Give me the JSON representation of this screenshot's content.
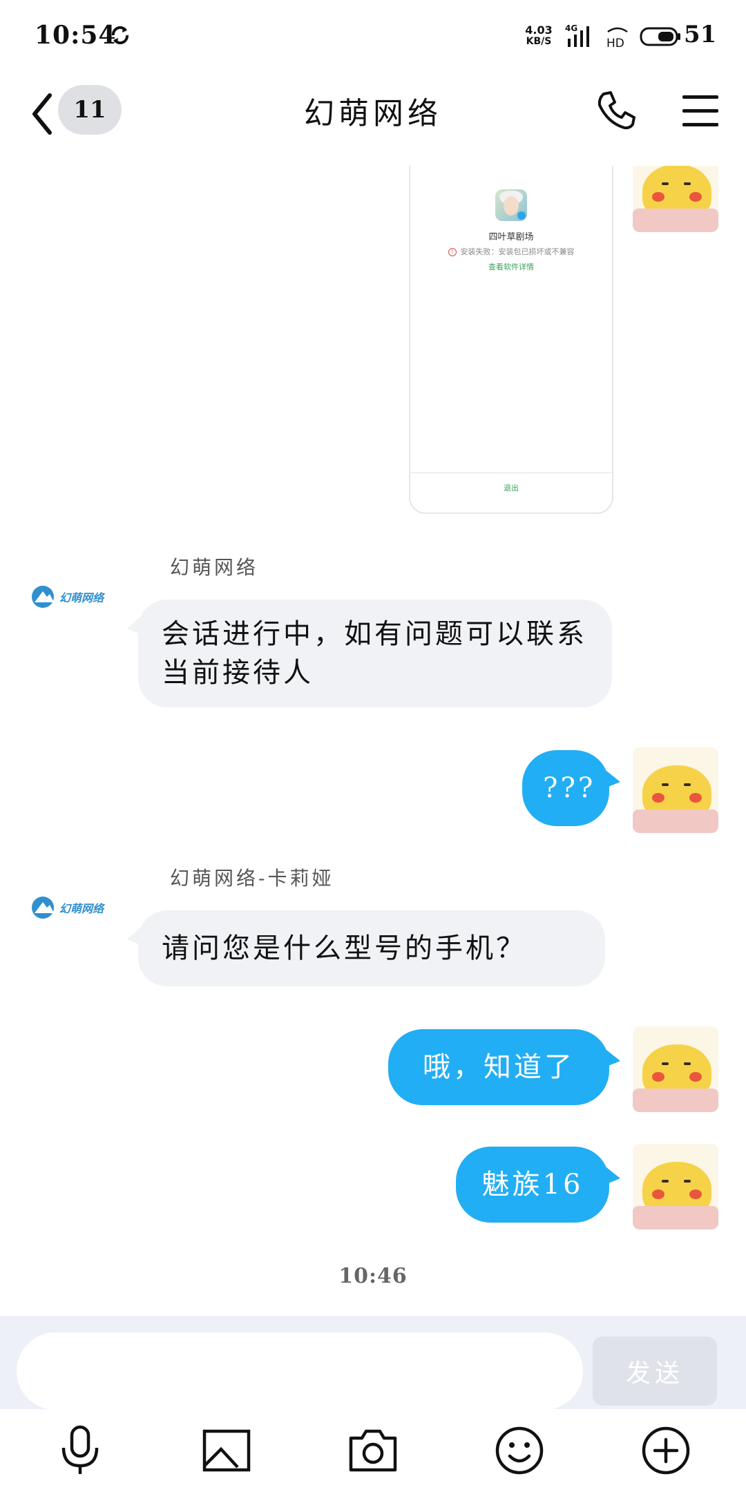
{
  "status_bar": {
    "time": "10:54",
    "net_speed_value": "4.03",
    "net_speed_unit": "KB/S",
    "network_type": "4G",
    "hd_label": "HD",
    "battery_level": "51"
  },
  "header": {
    "back_count": "11",
    "title": "幻萌网络"
  },
  "screenshot_card": {
    "app_name": "四叶草剧场",
    "error_text": "安装失败：安装包已损坏或不兼容",
    "detail_link": "查看软件详情",
    "exit_label": "退出"
  },
  "messages": [
    {
      "sender": "幻萌网络",
      "text": "会话进行中，如有问题可以联系当前接待人"
    },
    {
      "text": "???"
    },
    {
      "sender": "幻萌网络-卡莉娅",
      "text": "请问您是什么型号的手机？"
    },
    {
      "text": "哦，知道了"
    },
    {
      "text": "魅族16"
    }
  ],
  "bot_logo_text": "幻萌网络",
  "timestamp": "10:46",
  "input": {
    "placeholder": "",
    "value": "",
    "send_label": "发送"
  },
  "toolbar": [
    "mic-icon",
    "image-icon",
    "camera-icon",
    "emoji-icon",
    "plus-icon"
  ],
  "colors": {
    "bubble_out": "#21aef4",
    "bubble_in": "#f1f2f6",
    "input_bar_bg": "#edf0f7",
    "send_disabled": "#dfe2e9"
  }
}
